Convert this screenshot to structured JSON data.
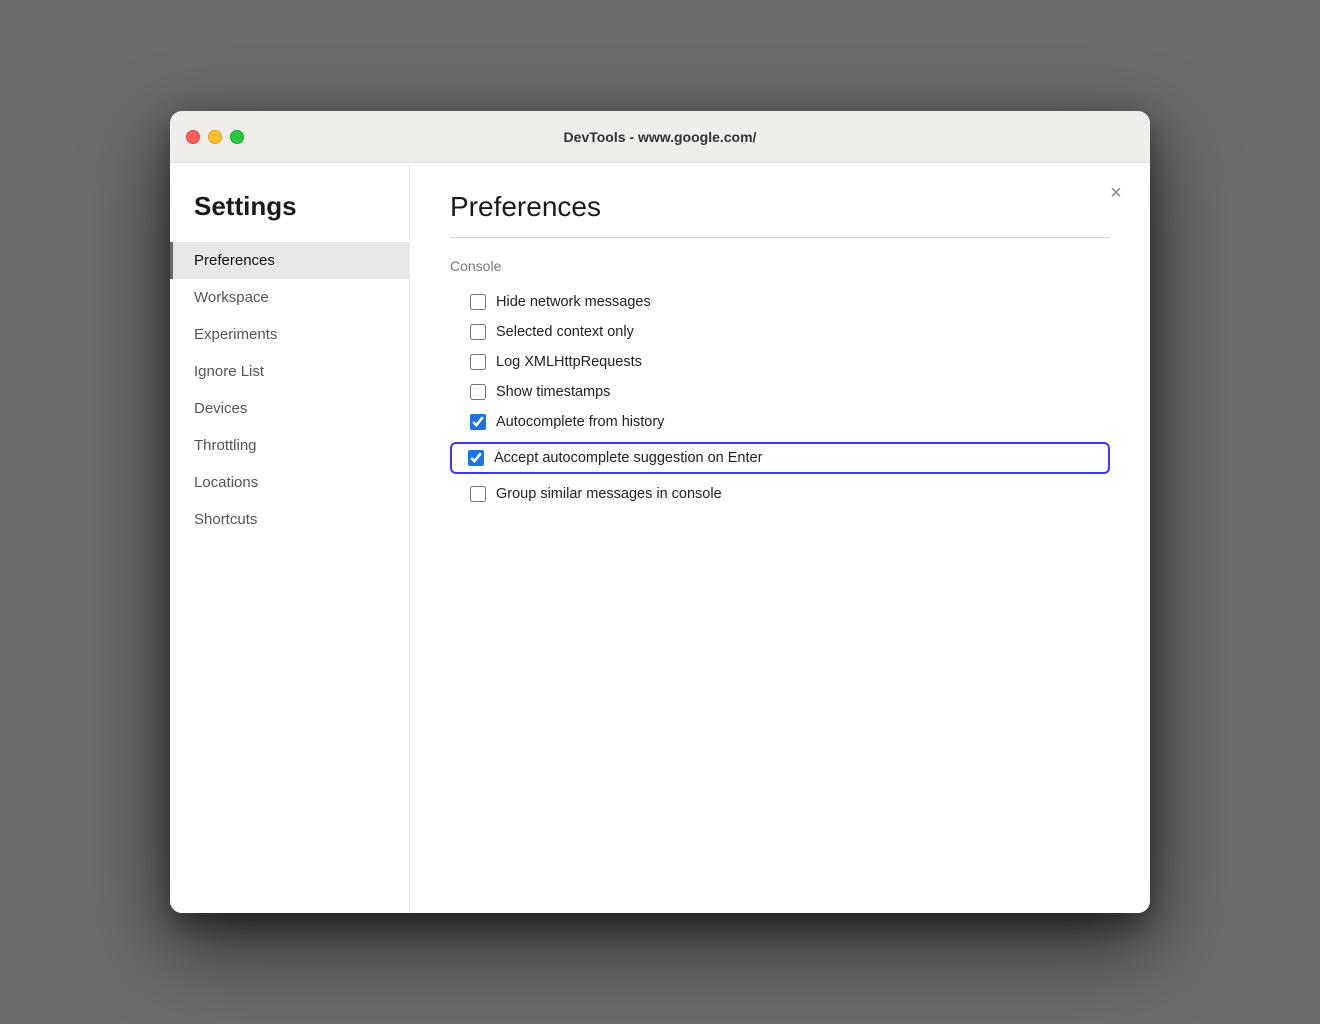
{
  "titleBar": {
    "title": "DevTools - www.google.com/"
  },
  "sidebar": {
    "heading": "Settings",
    "items": [
      {
        "id": "preferences",
        "label": "Preferences",
        "active": true
      },
      {
        "id": "workspace",
        "label": "Workspace",
        "active": false
      },
      {
        "id": "experiments",
        "label": "Experiments",
        "active": false
      },
      {
        "id": "ignore-list",
        "label": "Ignore List",
        "active": false
      },
      {
        "id": "devices",
        "label": "Devices",
        "active": false
      },
      {
        "id": "throttling",
        "label": "Throttling",
        "active": false
      },
      {
        "id": "locations",
        "label": "Locations",
        "active": false
      },
      {
        "id": "shortcuts",
        "label": "Shortcuts",
        "active": false
      }
    ]
  },
  "main": {
    "title": "Preferences",
    "closeLabel": "×",
    "groups": [
      {
        "label": "Console",
        "checkboxes": [
          {
            "id": "hide-network",
            "label": "Hide network messages",
            "checked": false,
            "highlighted": false
          },
          {
            "id": "selected-context",
            "label": "Selected context only",
            "checked": false,
            "highlighted": false
          },
          {
            "id": "log-xmlhttp",
            "label": "Log XMLHttpRequests",
            "checked": false,
            "highlighted": false
          },
          {
            "id": "show-timestamps",
            "label": "Show timestamps",
            "checked": false,
            "highlighted": false
          },
          {
            "id": "autocomplete-history",
            "label": "Autocomplete from history",
            "checked": true,
            "highlighted": false
          },
          {
            "id": "accept-autocomplete",
            "label": "Accept autocomplete suggestion on Enter",
            "checked": true,
            "highlighted": true
          },
          {
            "id": "group-similar",
            "label": "Group similar messages in console",
            "checked": false,
            "highlighted": false
          }
        ]
      }
    ]
  }
}
